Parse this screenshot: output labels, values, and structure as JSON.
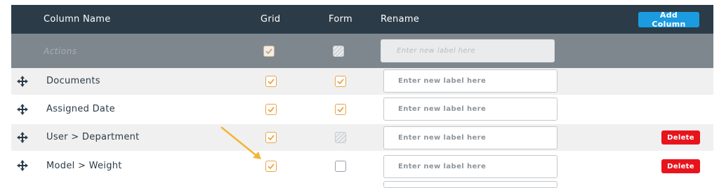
{
  "header": {
    "column_name": "Column Name",
    "grid": "Grid",
    "form": "Form",
    "rename": "Rename",
    "add_column": "Add Column"
  },
  "actions_row": {
    "label": "Actions",
    "placeholder": "Enter new label here",
    "grid_checked": true,
    "form_checked": false
  },
  "rows": [
    {
      "label": "Documents",
      "grid": "checked",
      "form": "checked",
      "placeholder": "Enter new label here",
      "delete": ""
    },
    {
      "label": "Assigned Date",
      "grid": "checked",
      "form": "checked",
      "placeholder": "Enter new label here",
      "delete": ""
    },
    {
      "label": "User > Department",
      "grid": "checked",
      "form": "disabled",
      "placeholder": "Enter new label here",
      "delete": "Delete"
    },
    {
      "label": "Model > Weight",
      "grid": "checked",
      "form": "unchecked",
      "placeholder": "Enter new label here",
      "delete": "Delete"
    }
  ],
  "colors": {
    "header_bg": "#2b3b48",
    "accent_blue": "#1b9be0",
    "delete_red": "#e8141c",
    "check_orange": "#e8a54a",
    "annotation_arrow": "#f2b53a"
  }
}
